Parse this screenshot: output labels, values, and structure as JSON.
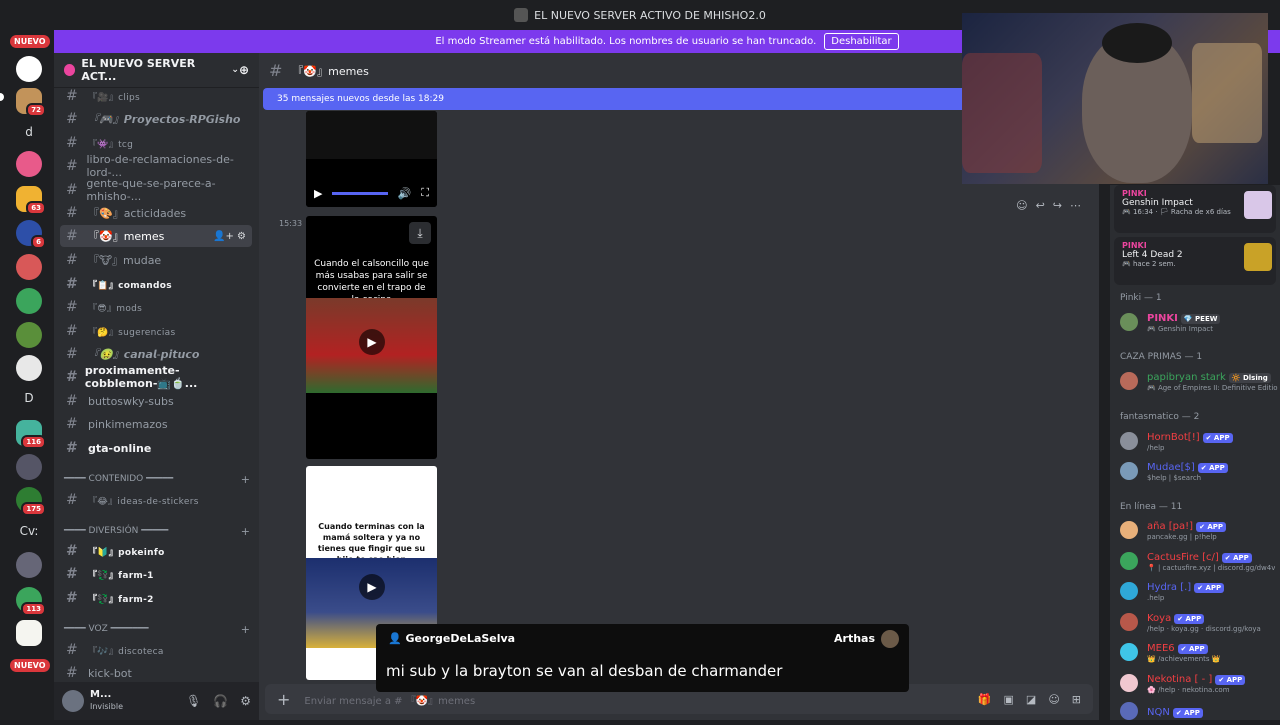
{
  "window_title": "EL NUEVO SERVER ACTIVO DE MHISHO2.0",
  "banner": {
    "text": "El modo Streamer está habilitado. Los nombres de usuario se han truncado.",
    "button": "Deshabilitar"
  },
  "guild_bar": {
    "top_pill": "NUEVO",
    "bottom_pill": "NUEVO",
    "badges": [
      "72",
      "63",
      "6",
      "116",
      "175",
      "113"
    ],
    "letters": [
      "d",
      "D",
      "Cv:"
    ]
  },
  "server": {
    "name": "EL NUEVO SERVER ACT..."
  },
  "channels": [
    {
      "name": "clips",
      "label": "『🎥』clips"
    },
    {
      "name": "proyectos",
      "label": "『🎮』𝙋𝙧𝙤𝙮𝙚𝙘𝙩𝙤𝙨-𝙍𝙋𝙂𝙞𝙨𝙝𝙤"
    },
    {
      "name": "tcg",
      "label": "『👾』tcg"
    },
    {
      "name": "libro",
      "label": "libro-de-reclamaciones-de-lord-..."
    },
    {
      "name": "gente",
      "label": "gente-que-se-parece-a-mhisho-..."
    },
    {
      "name": "acticidades",
      "label": "『🎨』acticidades"
    },
    {
      "name": "memes",
      "label": "『🤡』memes"
    },
    {
      "name": "mudae",
      "label": "『🐮』mudae"
    },
    {
      "name": "comandos",
      "label": "『📋』comandos"
    },
    {
      "name": "mods",
      "label": "『😎』mods"
    },
    {
      "name": "sugerencias",
      "label": "『🤔』sugerencias"
    },
    {
      "name": "canal-pituco",
      "label": "『🤢』𝙘𝙖𝙣𝙖𝙡-𝙥𝙞𝙩𝙪𝙘𝙤"
    },
    {
      "name": "cobblemon",
      "label": "proximamente-cobblemon-📺🍵..."
    },
    {
      "name": "buttoswky",
      "label": "buttoswky-subs"
    },
    {
      "name": "pinkimemazos",
      "label": "pinkimemazos"
    },
    {
      "name": "gta-online",
      "label": "gta-online"
    }
  ],
  "categories": {
    "contenido": "━━━━ CONTENIDO ━━━━━",
    "ideas": "『😂』ideas-de-stickers",
    "diversion": "━━━━ DIVERSIÓN ━━━━━",
    "pokeinfo": "『🔰』pokeinfo",
    "farm1": "『💱』farm-1",
    "farm2": "『💱』farm-2",
    "voz": "━━━━ VOZ ━━━━━━━",
    "discoteca": "『🎶』discoteca",
    "kickbot": "kick-bot"
  },
  "user_panel": {
    "name": "M...",
    "status": "Invisible"
  },
  "chat": {
    "channel_title": "『🤡』memes",
    "new_messages": "35 mensajes nuevos desde las 18:29",
    "timestamp": "15:33",
    "video1_caption": "Cuando el calsoncillo que más usabas para salir se convierte en el trapo de la cocina",
    "video2_caption": "Cuando terminas con la mamá soltera y ya no tienes que fingir que su hijo te cae bien",
    "composer_placeholder": "Enviar mensaje a # 『🤡』memes"
  },
  "activity": [
    {
      "who": "PINKI",
      "game": "Genshin Impact",
      "meta": "🎮 16:34 · 🏳 Racha de x6 días"
    },
    {
      "who": "PINKI",
      "game": "Left 4 Dead 2",
      "meta": "🎮 hace 2 sem."
    }
  ],
  "member_groups": [
    {
      "title": "Pinki — 1"
    },
    {
      "title": "CAZA PRIMAS — 1"
    },
    {
      "title": "fantasmatico — 2"
    },
    {
      "title": "En línea — 11"
    }
  ],
  "members": [
    {
      "name": "PINKI",
      "tag": "💎 PEEW",
      "sub": "🎮 Genshin Impact",
      "color": "#eb459e"
    },
    {
      "name": "papibryan stark",
      "tag": "🔆 Dlsing",
      "sub": "🎮 Age of Empires II: Definitive Editio",
      "color": "#3ba55c"
    },
    {
      "name": "HornBot[!]",
      "tag": "✔ APP",
      "sub": "/help",
      "color": "#f23f43"
    },
    {
      "name": "Mudae[$]",
      "tag": "✔ APP",
      "sub": "$help | $search",
      "color": "#5865f2"
    },
    {
      "name": "aña [pa!]",
      "tag": "✔ APP",
      "sub": "pancake.gg | p!help",
      "color": "#f23f43"
    },
    {
      "name": "CactusFire [c/]",
      "tag": "✔ APP",
      "sub": "📍 | cactusfire.xyz | discord.gg/dw4v",
      "color": "#f23f43"
    },
    {
      "name": "Hydra [.]",
      "tag": "✔ APP",
      "sub": ".help",
      "color": "#5865f2"
    },
    {
      "name": "Koya",
      "tag": "✔ APP",
      "sub": "/help · koya.gg · discord.gg/koya",
      "color": "#f23f43"
    },
    {
      "name": "MEE6",
      "tag": "✔ APP",
      "sub": "👑 /achievements 👑",
      "color": "#f23f43"
    },
    {
      "name": "Nekotina [ - ]",
      "tag": "✔ APP",
      "sub": "🌸 /help · nekotina.com",
      "color": "#f23f43"
    },
    {
      "name": "NQN",
      "tag": "✔ APP",
      "sub": "",
      "color": "#5865f2"
    }
  ],
  "subtitle_overlay": {
    "user": "GeorgeDeLaSelva",
    "user2": "Arthas",
    "text": "mi sub y la brayton se van al desban de charmander"
  }
}
